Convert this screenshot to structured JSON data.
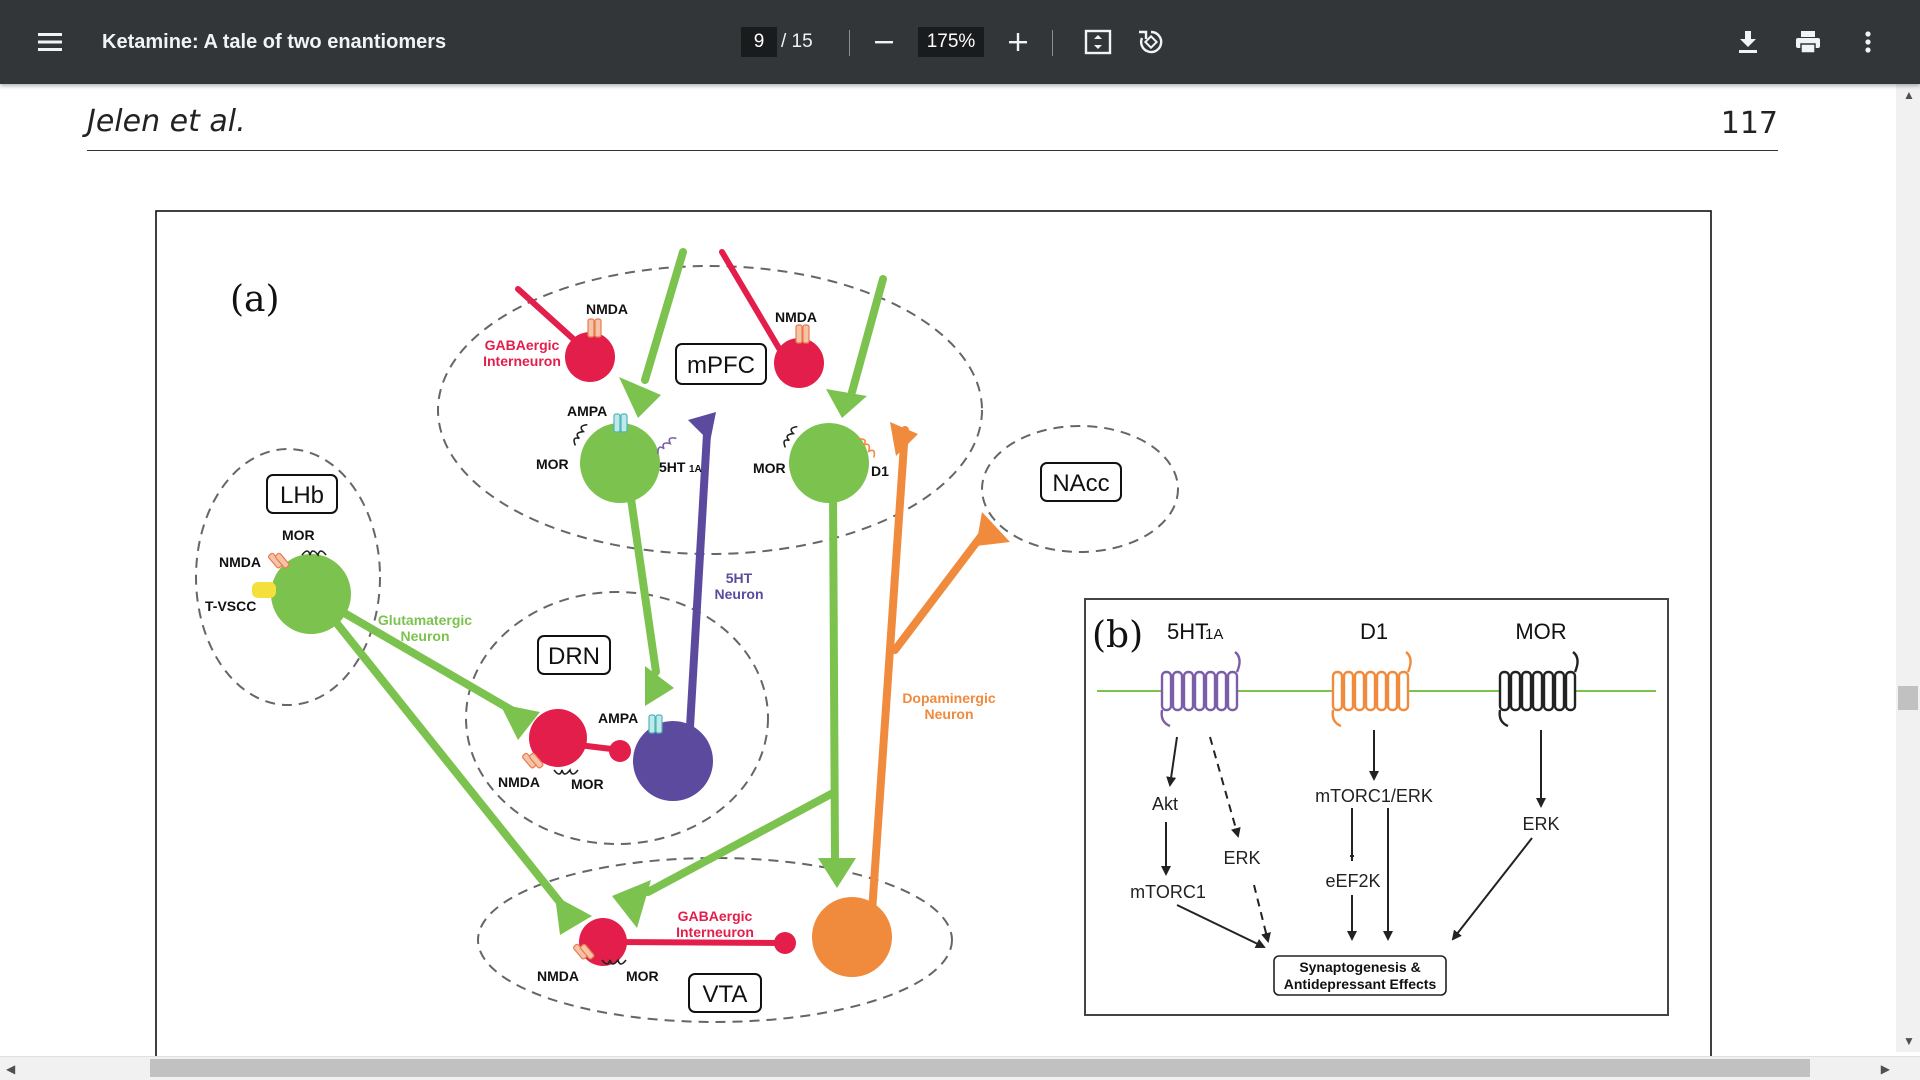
{
  "toolbar": {
    "title": "Ketamine: A tale of two enantiomers",
    "current_page": "9",
    "total_pages": "/ 15",
    "zoom": "175%",
    "icons": [
      "menu-icon",
      "zoom-out-icon",
      "zoom-in-icon",
      "fit-page-icon",
      "rotate-icon",
      "download-icon",
      "print-icon",
      "more-vert-icon"
    ]
  },
  "page": {
    "author": "Jelen et al.",
    "number": "117"
  },
  "figure": {
    "panel_a": {
      "label": "(a)",
      "regions": [
        "mPFC",
        "LHb",
        "DRN",
        "NAcc",
        "VTA"
      ],
      "receptors": {
        "nmda": "NMDA",
        "ampa": "AMPA",
        "mor": "MOR",
        "ht1a": "5HT",
        "ht1a_sub": "1A",
        "d1": "D1",
        "tvscc": "T-VSCC"
      },
      "neuron_labels": {
        "gaba_line1": "GABAergic",
        "gaba_line2": "Interneuron",
        "glut_line1": "Glutamatergic",
        "glut_line2": "Neuron",
        "ht_line1": "5HT",
        "ht_line2": "Neuron",
        "da_line1": "Dopaminergic",
        "da_line2": "Neuron"
      }
    },
    "panel_b": {
      "label": "(b)",
      "receptors": [
        {
          "name": "5HT",
          "sub": "1A",
          "color": "#7b5ea7"
        },
        {
          "name": "D1",
          "sub": "",
          "color": "#f08a3c"
        },
        {
          "name": "MOR",
          "sub": "",
          "color": "#222222"
        }
      ],
      "pathway": {
        "akt": "Akt",
        "mtorc1": "mTORC1",
        "erk_5ht": "ERK",
        "mtorc1_erk": "mTORC1/ERK",
        "eef2k": "eEF2K",
        "erk_mor": "ERK",
        "outcome_line1": "Synaptogenesis &",
        "outcome_line2": "Antidepressant Effects"
      }
    },
    "colors": {
      "green": "#7cc24e",
      "red": "#e31e4a",
      "purple": "#5b4a9e",
      "orange": "#f08a3c",
      "dashed": "#666666"
    }
  }
}
